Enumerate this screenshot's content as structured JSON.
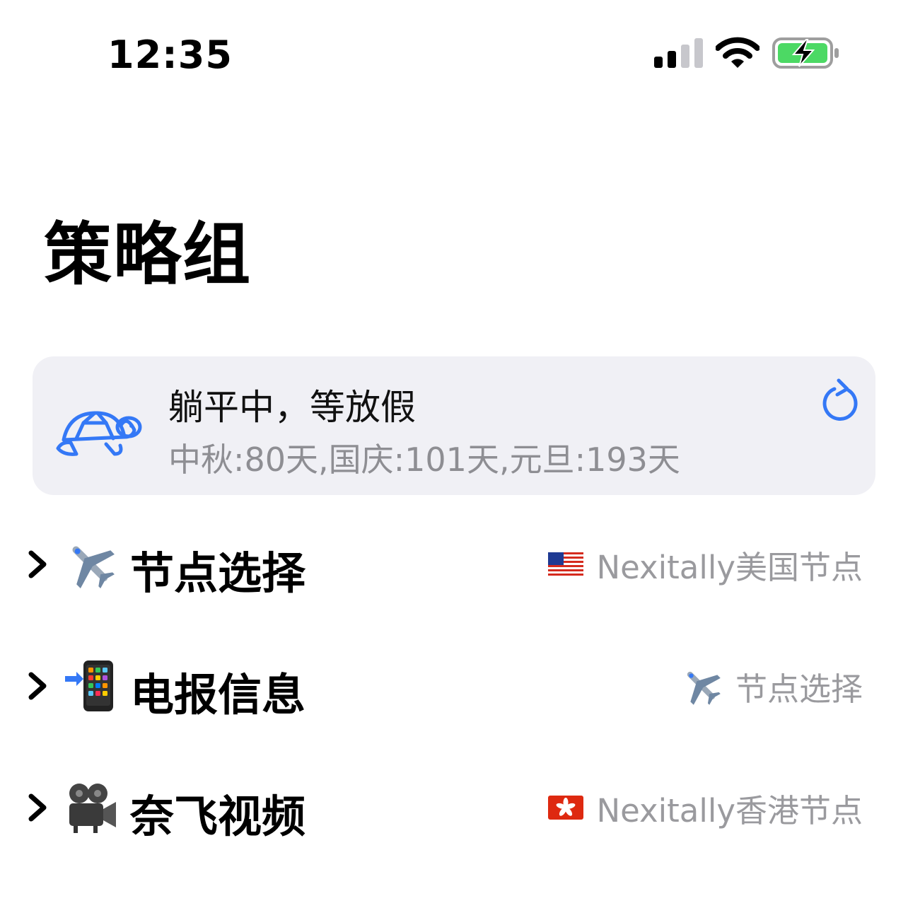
{
  "status_bar": {
    "time": "12:35"
  },
  "page": {
    "title": "策略组"
  },
  "banner": {
    "title": "躺平中，等放假",
    "subtitle": "中秋:80天,国庆:101天,元旦:193天",
    "icon": "turtle-icon",
    "action_icon": "refresh-icon"
  },
  "groups": [
    {
      "title": "节点选择",
      "emoji": "airplane-icon",
      "value": "Nexitally美国节点",
      "value_icon": "us-flag-icon"
    },
    {
      "title": "电报信息",
      "emoji": "mobile-phone-arrow-icon",
      "value": "节点选择",
      "value_icon": "airplane-icon"
    },
    {
      "title": "奈飞视频",
      "emoji": "movie-camera-icon",
      "value": "Nexitally香港节点",
      "value_icon": "hk-flag-icon"
    }
  ],
  "colors": {
    "accent": "#3478f6",
    "banner_bg": "#f0f0f5",
    "secondary_text": "#8e8e93"
  }
}
